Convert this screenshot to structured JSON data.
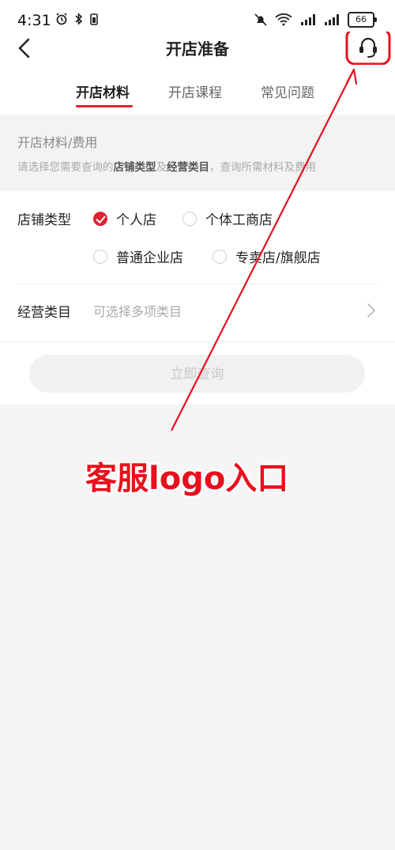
{
  "status_bar": {
    "time": "4:31",
    "battery": "66",
    "icons": [
      "alarm-icon",
      "bluetooth-icon",
      "mute-icon",
      "wifi-icon",
      "signal-icon",
      "signal-icon",
      "battery-icon"
    ]
  },
  "header": {
    "title": "开店准备",
    "back_icon": "chevron-left-icon",
    "service_icon": "headset-icon"
  },
  "tabs": [
    {
      "label": "开店材料",
      "active": true
    },
    {
      "label": "开店课程",
      "active": false
    },
    {
      "label": "常见问题",
      "active": false
    }
  ],
  "info": {
    "heading": "开店材料/费用",
    "desc_prefix": "请选择您需要查询的",
    "desc_bold1": "店铺类型",
    "desc_mid": "及",
    "desc_bold2": "经营类目",
    "desc_suffix": "，查询所需材料及费用"
  },
  "form": {
    "shop_type_label": "店铺类型",
    "shop_types": [
      {
        "label": "个人店",
        "selected": true
      },
      {
        "label": "个体工商店",
        "selected": false
      },
      {
        "label": "普通企业店",
        "selected": false
      },
      {
        "label": "专卖店/旗舰店",
        "selected": false
      }
    ],
    "category_label": "经营类目",
    "category_placeholder": "可选择多项类目",
    "query_button": "立即查询"
  },
  "annotation": {
    "text": "客服logo入口",
    "color": "#e8101c"
  },
  "colors": {
    "accent": "#e0222f",
    "background": "#f5f5f5"
  }
}
